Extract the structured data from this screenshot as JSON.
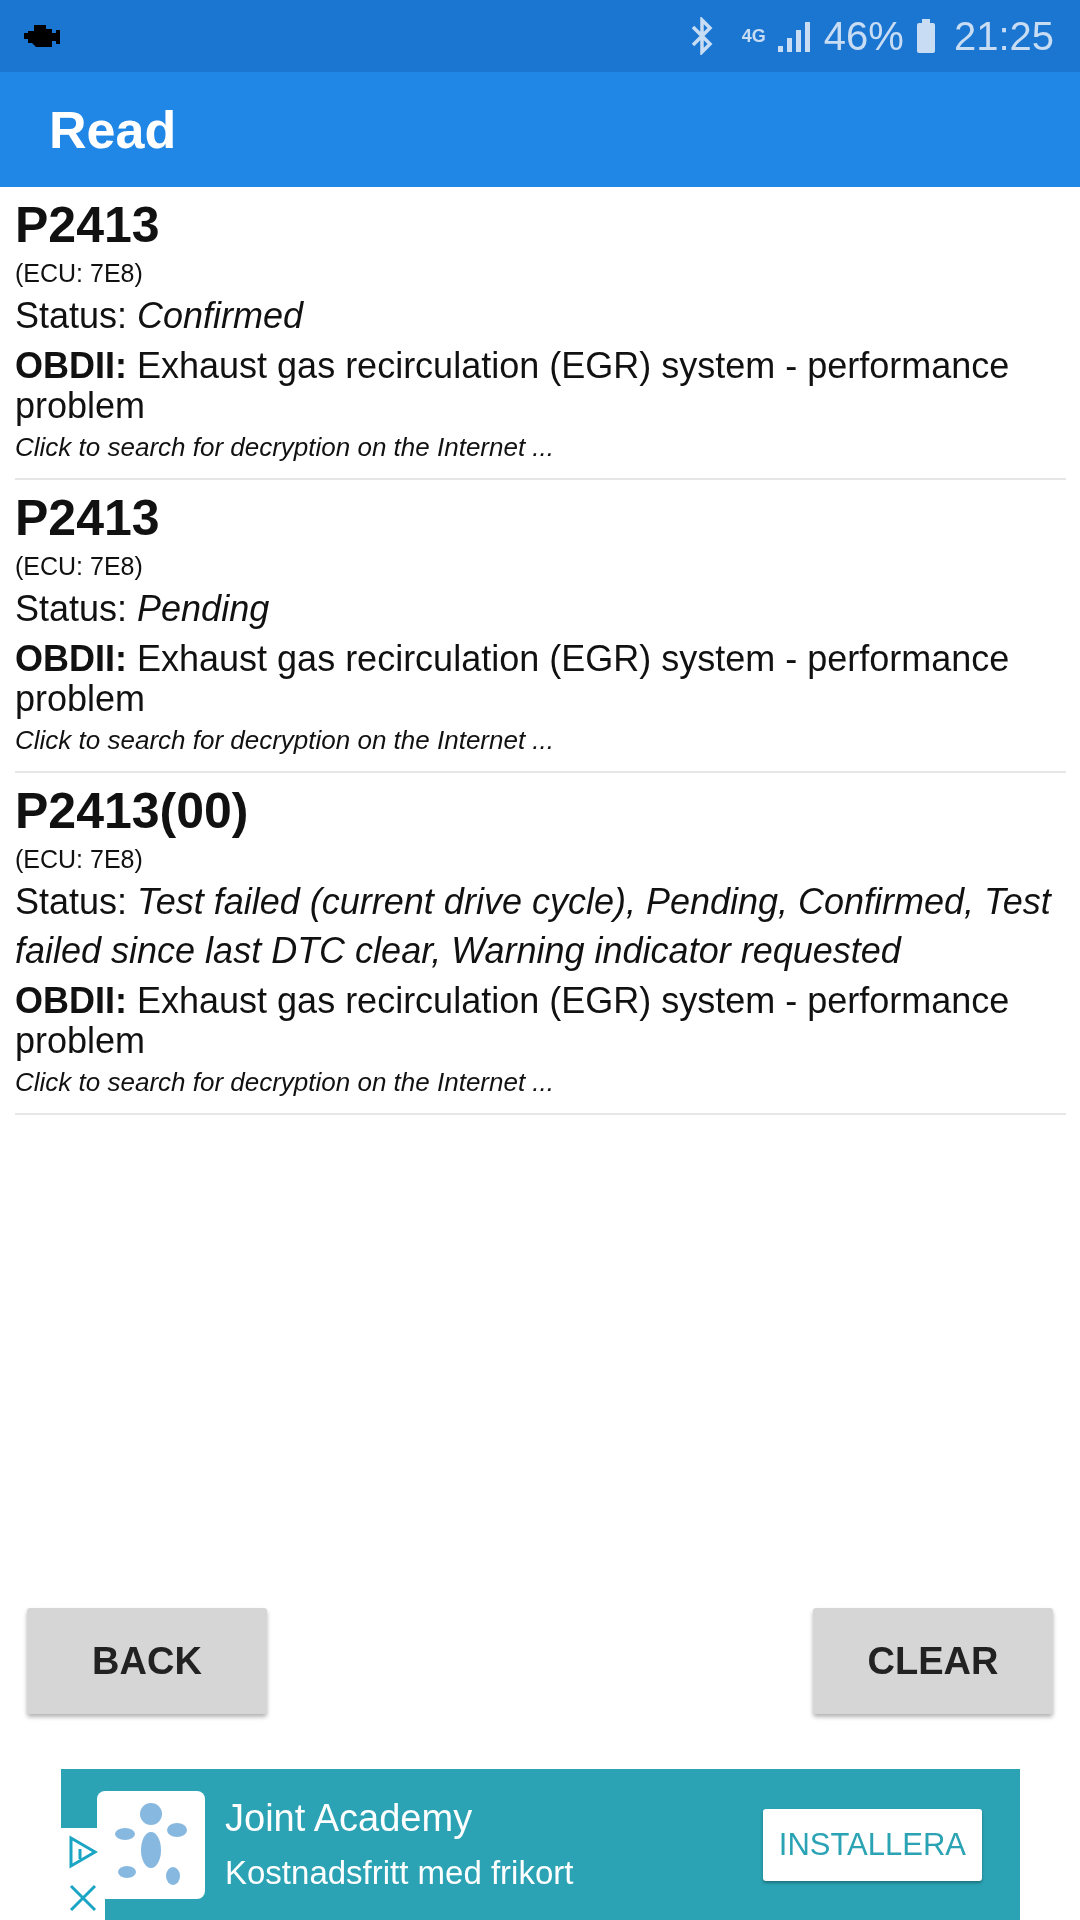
{
  "status_bar": {
    "battery_text": "46%",
    "network": "4G",
    "time": "21:25"
  },
  "app_bar": {
    "title": "Read"
  },
  "codes": [
    {
      "code": "P2413",
      "ecu": "(ECU: 7E8)",
      "status_label": "Status:",
      "status": "Confirmed",
      "source": "OBDII:",
      "description": "Exhaust gas recirculation (EGR) system - performance problem",
      "hint": "Click to search for decryption on the Internet ..."
    },
    {
      "code": "P2413",
      "ecu": "(ECU: 7E8)",
      "status_label": "Status:",
      "status": "Pending",
      "source": "OBDII:",
      "description": "Exhaust gas recirculation (EGR) system - performance problem",
      "hint": "Click to search for decryption on the Internet ..."
    },
    {
      "code": "P2413(00)",
      "ecu": "(ECU: 7E8)",
      "status_label": "Status:",
      "status": "Test failed (current drive cycle), Pending, Confirmed, Test failed since last DTC clear, Warning indicator requested",
      "source": "OBDII:",
      "description": "Exhaust gas recirculation (EGR) system - performance problem",
      "hint": "Click to search for decryption on the Internet ..."
    }
  ],
  "buttons": [
    "BACK",
    "CLEAR"
  ],
  "ad": {
    "title": "Joint Academy",
    "subtitle": "Kostnadsfritt med frikort",
    "action": "INSTALLERA"
  }
}
